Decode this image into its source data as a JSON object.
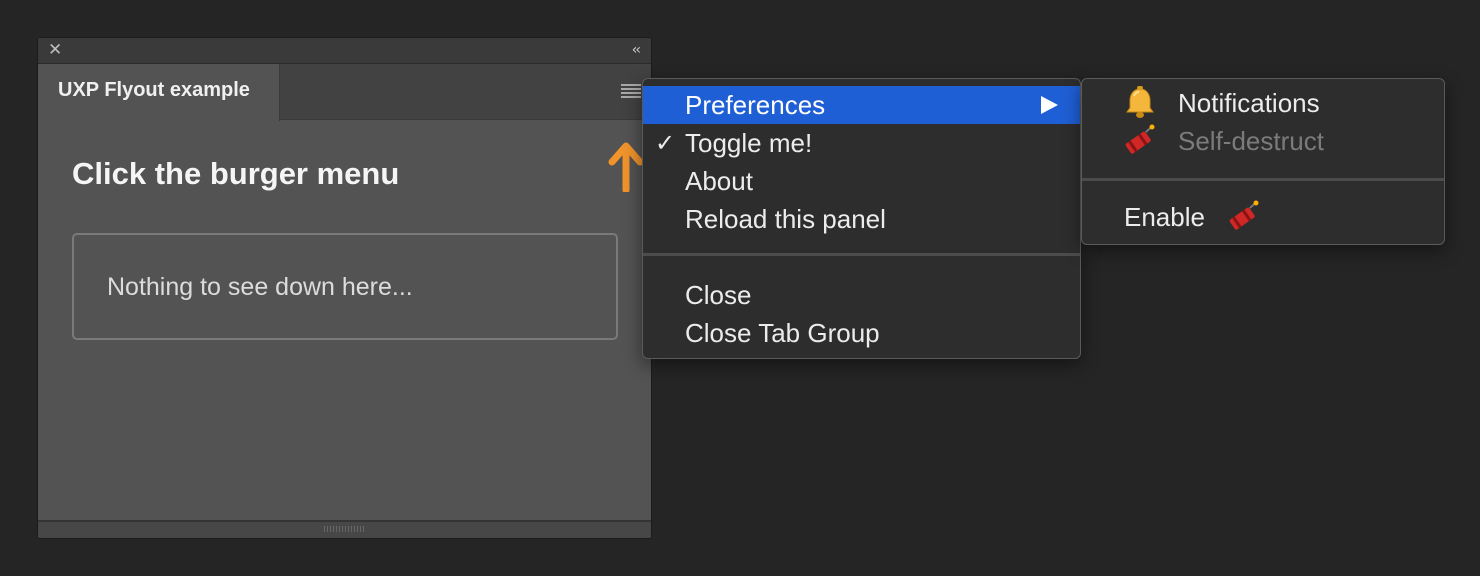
{
  "panel": {
    "tab_title": "UXP Flyout example",
    "heading": "Click the burger menu",
    "box_text": "Nothing to see down here..."
  },
  "menu": {
    "items": [
      {
        "label": "Preferences",
        "submenu": true,
        "highlighted": true
      },
      {
        "label": "Toggle me!",
        "checked": true
      },
      {
        "label": "About"
      },
      {
        "label": "Reload this panel"
      },
      {
        "label": "Close"
      },
      {
        "label": "Close Tab Group"
      }
    ]
  },
  "submenu": {
    "items": [
      {
        "label": "Notifications",
        "icon": "bell-icon"
      },
      {
        "label": "Self-destruct",
        "icon": "dynamite-icon",
        "disabled": true
      },
      {
        "label": "Enable",
        "icon": "dynamite-icon"
      }
    ]
  },
  "colors": {
    "background": "#252525",
    "panel": "#535353",
    "menu": "#2d2d2d",
    "highlight": "#1f5fd6",
    "arrow": "#f0932b"
  }
}
